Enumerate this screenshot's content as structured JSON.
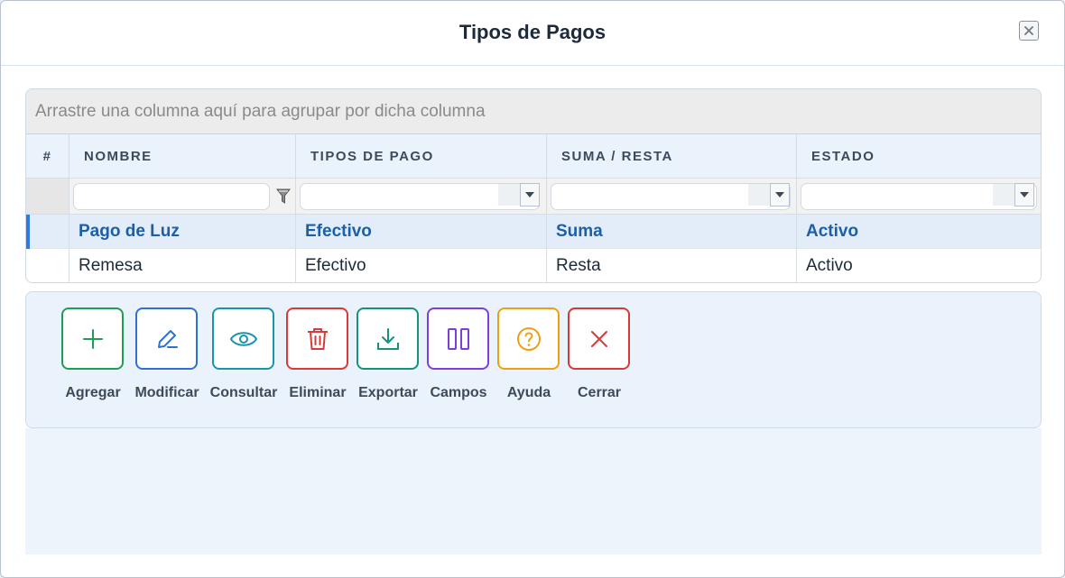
{
  "dialog": {
    "title": "Tipos de Pagos",
    "close_icon": "close-icon"
  },
  "grid": {
    "group_panel_text": "Arrastre una columna aquí para agrupar por dicha columna",
    "columns": [
      "#",
      "NOMBRE",
      "TIPOS DE PAGO",
      "SUMA / RESTA",
      "ESTADO"
    ],
    "rows": [
      {
        "nombre": "Pago de Luz",
        "tipo": "Efectivo",
        "suma_resta": "Suma",
        "estado": "Activo",
        "selected": true
      },
      {
        "nombre": "Remesa",
        "tipo": "Efectivo",
        "suma_resta": "Resta",
        "estado": "Activo",
        "selected": false
      }
    ]
  },
  "toolbar": {
    "buttons": [
      {
        "label": "Agregar",
        "icon": "plus-icon",
        "color": "#1e9e52"
      },
      {
        "label": "Modificar",
        "icon": "pencil-icon",
        "color": "#2f6fd6"
      },
      {
        "label": "Consultar",
        "icon": "eye-icon",
        "color": "#1b93a8"
      },
      {
        "label": "Eliminar",
        "icon": "trash-icon",
        "color": "#d63a3a"
      },
      {
        "label": "Exportar",
        "icon": "download-icon",
        "color": "#17917a"
      },
      {
        "label": "Campos",
        "icon": "columns-icon",
        "color": "#7d3ed9"
      },
      {
        "label": "Ayuda",
        "icon": "help-icon",
        "color": "#eea014"
      },
      {
        "label": "Cerrar",
        "icon": "close-icon",
        "color": "#d33a3a"
      }
    ]
  }
}
